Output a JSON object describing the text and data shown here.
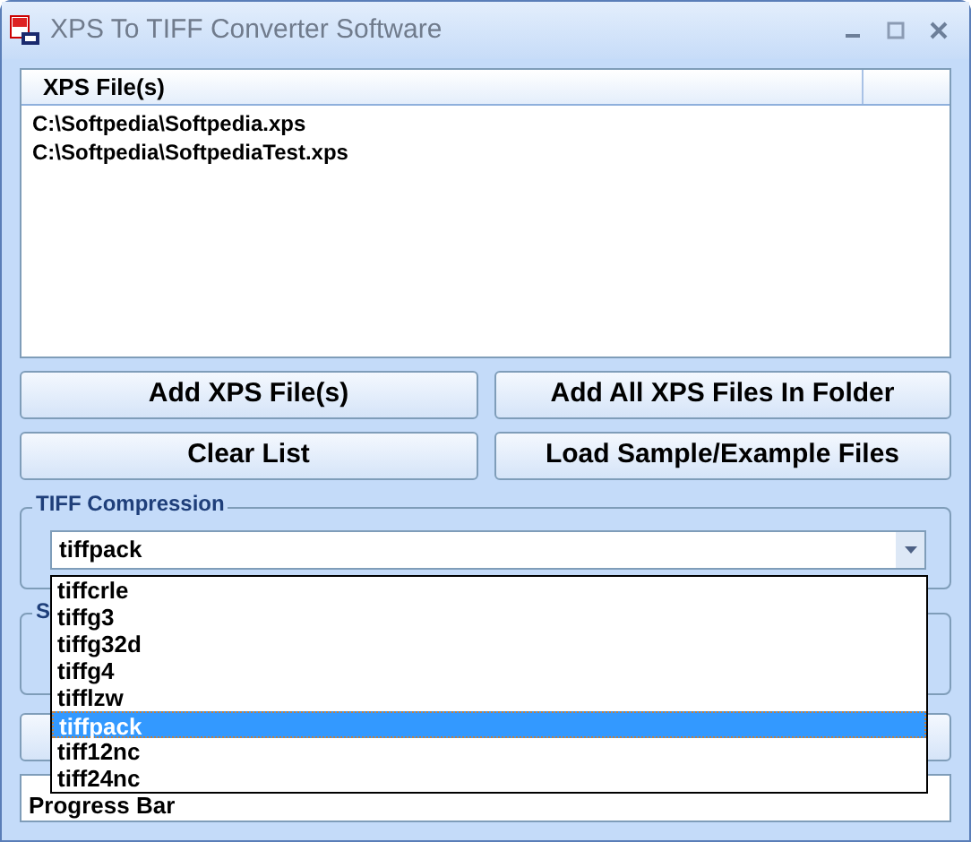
{
  "window": {
    "title": "XPS To TIFF Converter Software"
  },
  "file_list": {
    "column": "XPS File(s)",
    "rows": [
      "C:\\Softpedia\\Softpedia.xps",
      "C:\\Softpedia\\SoftpediaTest.xps"
    ]
  },
  "buttons": [
    "Add XPS File(s)",
    "Add All XPS Files In Folder",
    "Clear List",
    "Load Sample/Example Files"
  ],
  "compression": {
    "title": "TIFF Compression",
    "value": "tiffpack",
    "expanded": true,
    "options": [
      {
        "label": "tiffcrle",
        "selected": false
      },
      {
        "label": "tiffg3",
        "selected": false
      },
      {
        "label": "tiffg32d",
        "selected": false
      },
      {
        "label": "tiffg4",
        "selected": false
      },
      {
        "label": "tifflzw",
        "selected": false
      },
      {
        "label": "tiffpack",
        "selected": true
      },
      {
        "label": "tiff12nc",
        "selected": false
      },
      {
        "label": "tiff24nc",
        "selected": false
      }
    ]
  },
  "group_2": {
    "title": "S"
  },
  "progress": {
    "label": "Progress Bar"
  }
}
